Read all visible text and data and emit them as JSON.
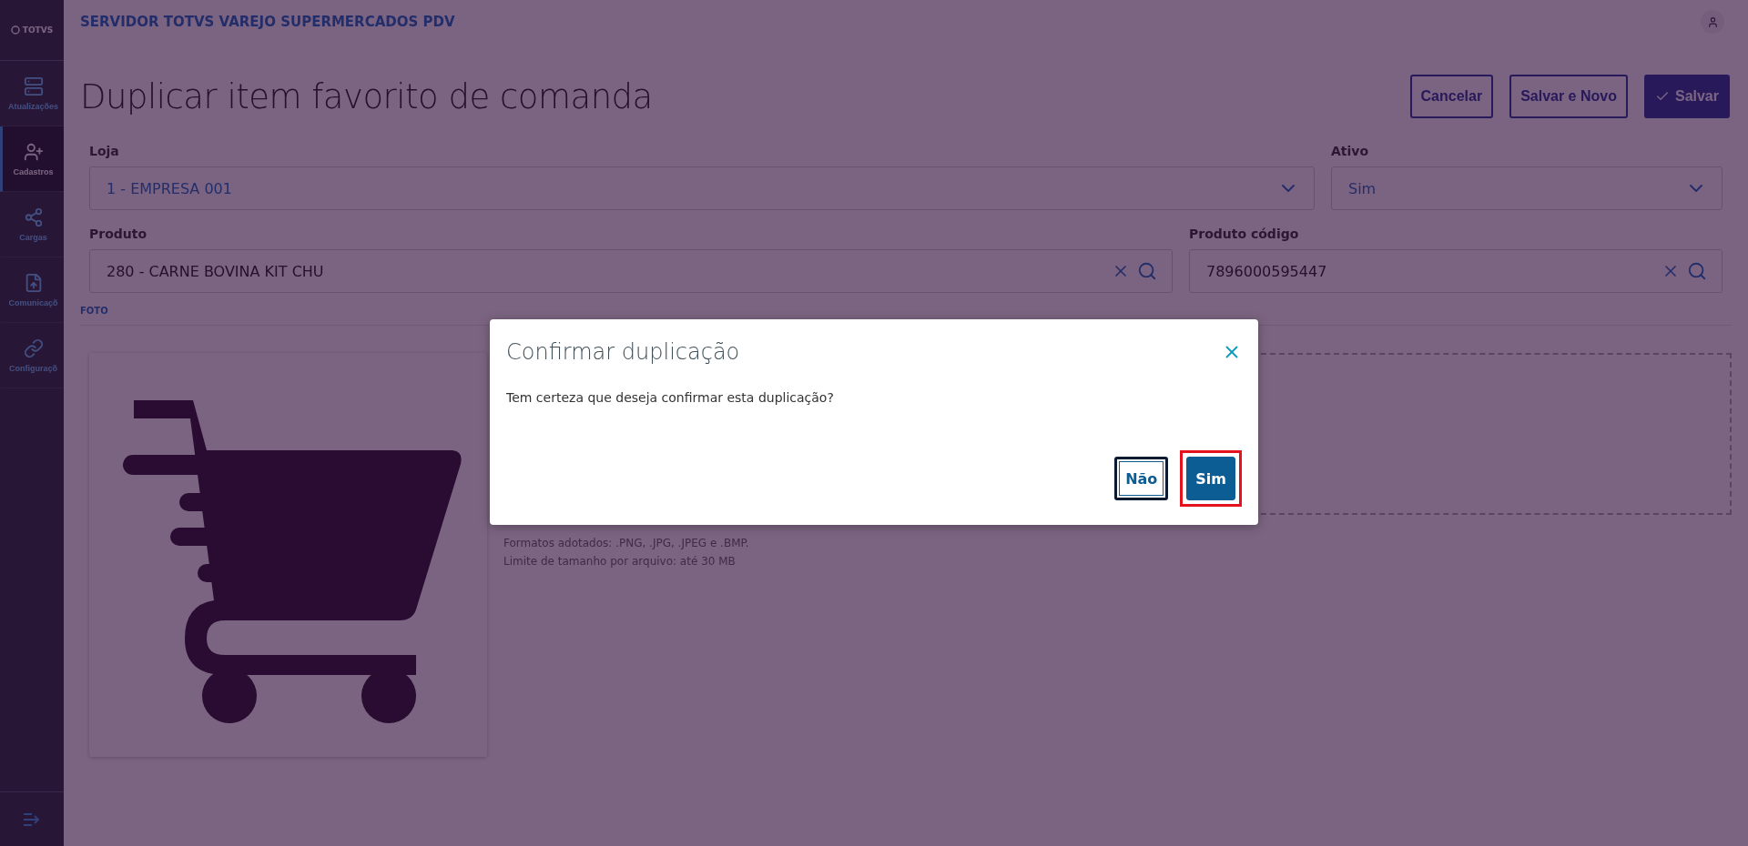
{
  "app": {
    "logo": "TOTVS",
    "server_title": "SERVIDOR TOTVS VAREJO SUPERMERCADOS PDV"
  },
  "sidebar": {
    "items": [
      {
        "label": "Atualizações",
        "kind": "server",
        "selected": false
      },
      {
        "label": "Cadastros",
        "kind": "user-add",
        "selected": true
      },
      {
        "label": "Cargas",
        "kind": "share",
        "selected": false
      },
      {
        "label": "Comunicaçõ",
        "kind": "upload",
        "selected": false
      },
      {
        "label": "Configuraçõ",
        "kind": "link",
        "selected": false
      }
    ]
  },
  "page": {
    "title": "Duplicar item favorito de comanda",
    "actions": [
      {
        "label": "Cancelar",
        "kind": "outline"
      },
      {
        "label": "Salvar e Novo",
        "kind": "outline"
      },
      {
        "label": "Salvar",
        "kind": "primary"
      }
    ]
  },
  "form": {
    "rows": [
      {
        "fields": [
          {
            "label": "Loja",
            "value": "1 - EMPRESA 001",
            "kind": "select"
          },
          {
            "label": "Ativo",
            "value": "Sim",
            "kind": "select"
          }
        ]
      },
      {
        "fields": [
          {
            "label": "Produto",
            "value": "280 - CARNE BOVINA KIT CHU",
            "kind": "lookup"
          },
          {
            "label": "Produto código",
            "value": "7896000595447",
            "kind": "lookup"
          }
        ]
      }
    ]
  },
  "photo": {
    "section_label": "FOTO",
    "upload_notes": [
      "Formatos adotados: .PNG, .JPG, .JPEG e .BMP.",
      "Limite de tamanho por arquivo: até 30 MB"
    ]
  },
  "dialog": {
    "title": "Confirmar duplicação",
    "message": "Tem certeza que deseja confirmar esta duplicação?",
    "buttons": [
      {
        "label": "Não",
        "kind": "secondary",
        "focused": true,
        "highlighted": false
      },
      {
        "label": "Sim",
        "kind": "primary",
        "focused": false,
        "highlighted": true
      }
    ]
  }
}
